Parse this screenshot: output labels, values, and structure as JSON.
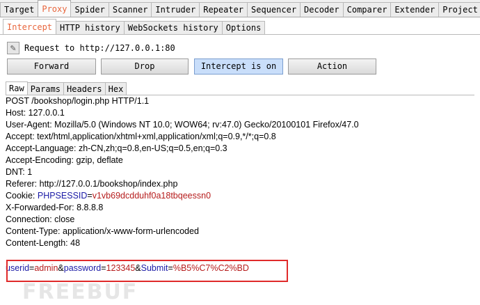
{
  "top_tabs": [
    "Target",
    "Proxy",
    "Spider",
    "Scanner",
    "Intruder",
    "Repeater",
    "Sequencer",
    "Decoder",
    "Comparer",
    "Extender",
    "Project option"
  ],
  "sub_tabs": [
    "Intercept",
    "HTTP history",
    "WebSockets history",
    "Options"
  ],
  "request_label": "Request to http://127.0.0.1:80",
  "buttons": {
    "forward": "Forward",
    "drop": "Drop",
    "intercept": "Intercept is on",
    "action": "Action"
  },
  "message_tabs": [
    "Raw",
    "Params",
    "Headers",
    "Hex"
  ],
  "request": {
    "request_line": "POST /bookshop/login.php HTTP/1.1",
    "host": "Host: 127.0.0.1",
    "user_agent": "User-Agent: Mozilla/5.0 (Windows NT 10.0; WOW64; rv:47.0) Gecko/20100101 Firefox/47.0",
    "accept": "Accept: text/html,application/xhtml+xml,application/xml;q=0.9,*/*;q=0.8",
    "accept_language": "Accept-Language: zh-CN,zh;q=0.8,en-US;q=0.5,en;q=0.3",
    "accept_encoding": "Accept-Encoding: gzip, deflate",
    "dnt": "DNT: 1",
    "referer": "Referer: http://127.0.0.1/bookshop/index.php",
    "cookie_label": "Cookie: ",
    "cookie_name": "PHPSESSID",
    "cookie_eq": "=",
    "cookie_value": "v1vb69dcdduhf0a18tbqeessn0",
    "xff_x": "X",
    "xff_rest": "-Forwarded-For: 8.8.8.8",
    "connection": "Connection: close",
    "content_type": "Content-Type: application/x-www-form-urlencoded",
    "content_length": "Content-Length: 48",
    "params": {
      "p1_name": "userid",
      "p1_value": "admin",
      "p2_name": "password",
      "p2_value": "123345",
      "p3_name": "Submit",
      "p3_value": "%B5%C7%C2%BD",
      "eq": "=",
      "amp": "&"
    }
  },
  "watermark": "FREEBUF",
  "colors": {
    "active_tab": "#e8663d",
    "param_name": "#1a1aa6",
    "param_value": "#b61c1c",
    "highlight_box": "#e02a2a"
  }
}
